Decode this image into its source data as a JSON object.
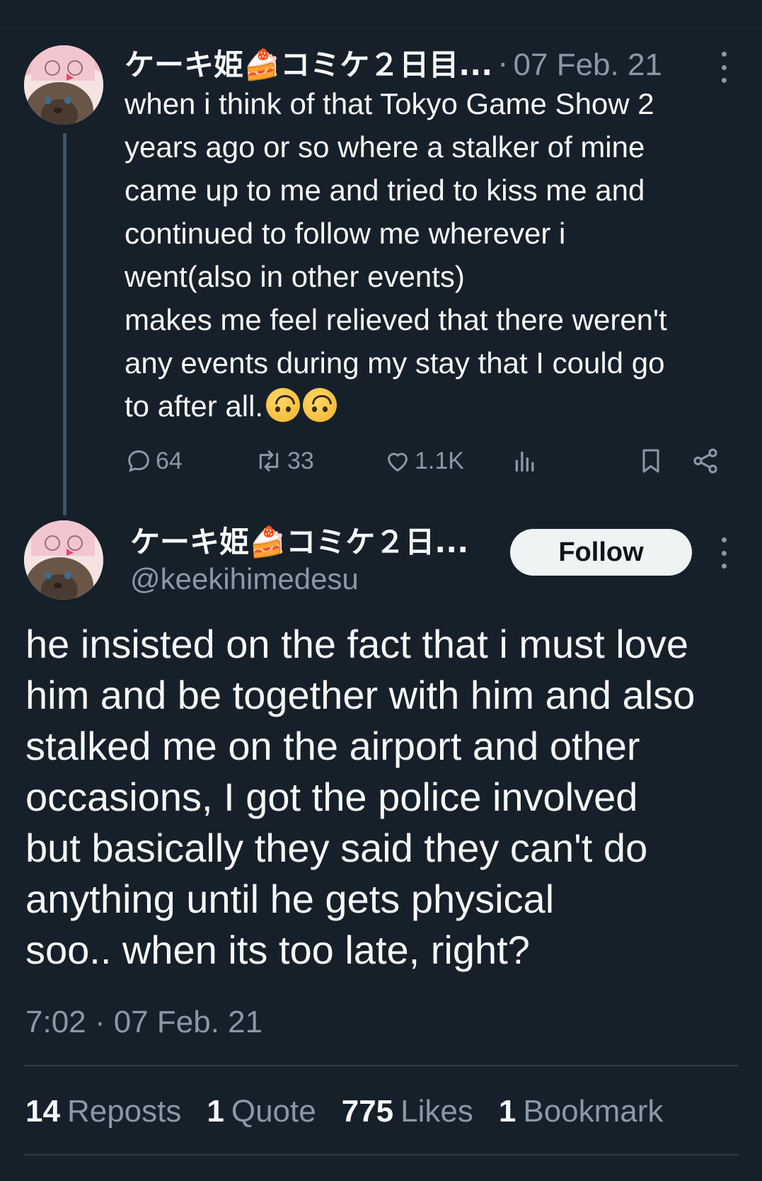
{
  "tweet1": {
    "author_name": "ケーキ姫🍰コミケ２日目...",
    "separator": "·",
    "date": "07 Feb. 21",
    "text": "when i think of that Tokyo Game Show 2\nyears ago or so where a stalker of mine\ncame up to me and tried to kiss me and\ncontinued to follow me wherever i\nwent(also in other events)\nmakes me feel relieved that there weren't\nany events during my stay that I could go\nto after all.",
    "emoji_name": "upside-down-face",
    "actions": {
      "replies": "64",
      "reposts": "33",
      "likes": "1.1K"
    }
  },
  "tweet2": {
    "author_name": "ケーキ姫🍰コミケ２日...",
    "handle": "@keekihimedesu",
    "follow_label": "Follow",
    "text": "he insisted on the fact that i must love\nhim and be together with him and also\nstalked me on the airport and other\noccasions, I got the police involved\nbut basically they said they can't do\nanything until he gets physical\nsoo.. when its too late, right?",
    "timestamp": "7:02 · 07 Feb. 21",
    "stats": [
      {
        "count": "14",
        "label": "Reposts"
      },
      {
        "count": "1",
        "label": "Quote"
      },
      {
        "count": "775",
        "label": "Likes"
      },
      {
        "count": "1",
        "label": "Bookmark"
      }
    ]
  },
  "colors": {
    "background": "#15202b",
    "text_primary": "#f7f9f9",
    "text_secondary": "#8b98a5",
    "follow_button": "#eff3f4"
  }
}
